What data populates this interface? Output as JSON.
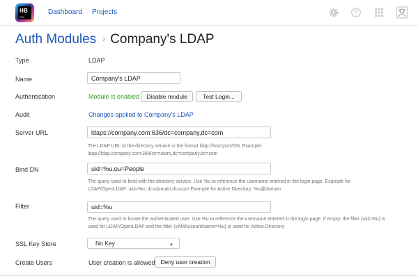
{
  "nav": {
    "logo_text": "HB",
    "links": [
      "Dashboard",
      "Projects"
    ],
    "icons": [
      "settings-gear-icon",
      "help-icon",
      "apps-grid-icon",
      "user-avatar-icon"
    ]
  },
  "heading": {
    "breadcrumb": "Auth Modules",
    "separator": "›",
    "title": "Company's LDAP"
  },
  "form": {
    "type": {
      "label": "Type",
      "value": "LDAP"
    },
    "name": {
      "label": "Name",
      "value": "Company's LDAP"
    },
    "authentication": {
      "label": "Authentication",
      "status": "Module is enabled",
      "disable_button": "Disable module",
      "test_button": "Test Login..."
    },
    "audit": {
      "label": "Audit",
      "link": "Changes applied to Company's LDAP"
    },
    "server_url": {
      "label": "Server URL",
      "value": "ldaps://company.com:636/dc=company,dc=com",
      "hint_1": "The LDAP URL of the directory service in the format ldap://host:port/DN. Example:",
      "hint_2": "ldap://ldap.company.com:389/cn=users,dc=company,dc=com"
    },
    "bind_dn": {
      "label": "Bind DN",
      "value": "uid=%u,ou=People",
      "hint_1": "The query used to bind with the directory service. Use %u to reference the username entered in the login page. Example for",
      "hint_2": "LDAP/OpenLDAP: uid=%u, dc=domain,dc=com Example for Active Directory: %u@domain"
    },
    "filter": {
      "label": "Filter",
      "value": "uid=%u",
      "hint_1": "The query used to locate the authenticated user. Use %u to reference the username entered in the login page. If empty, the filter (uid=%u) is",
      "hint_2": "used for LDAP/OpenLDAP and the filter (sAMAccountName=%u) is used for Active Directory"
    },
    "ssl_key_store": {
      "label": "SSL Key Store",
      "selected": "No Key"
    },
    "create_users": {
      "label": "Create Users",
      "status": "User creation is allowed",
      "button": "Deny user creation"
    }
  },
  "colors": {
    "link": "#1a58b8",
    "enabled_green": "#3f9b22",
    "hint_text": "#707070"
  }
}
